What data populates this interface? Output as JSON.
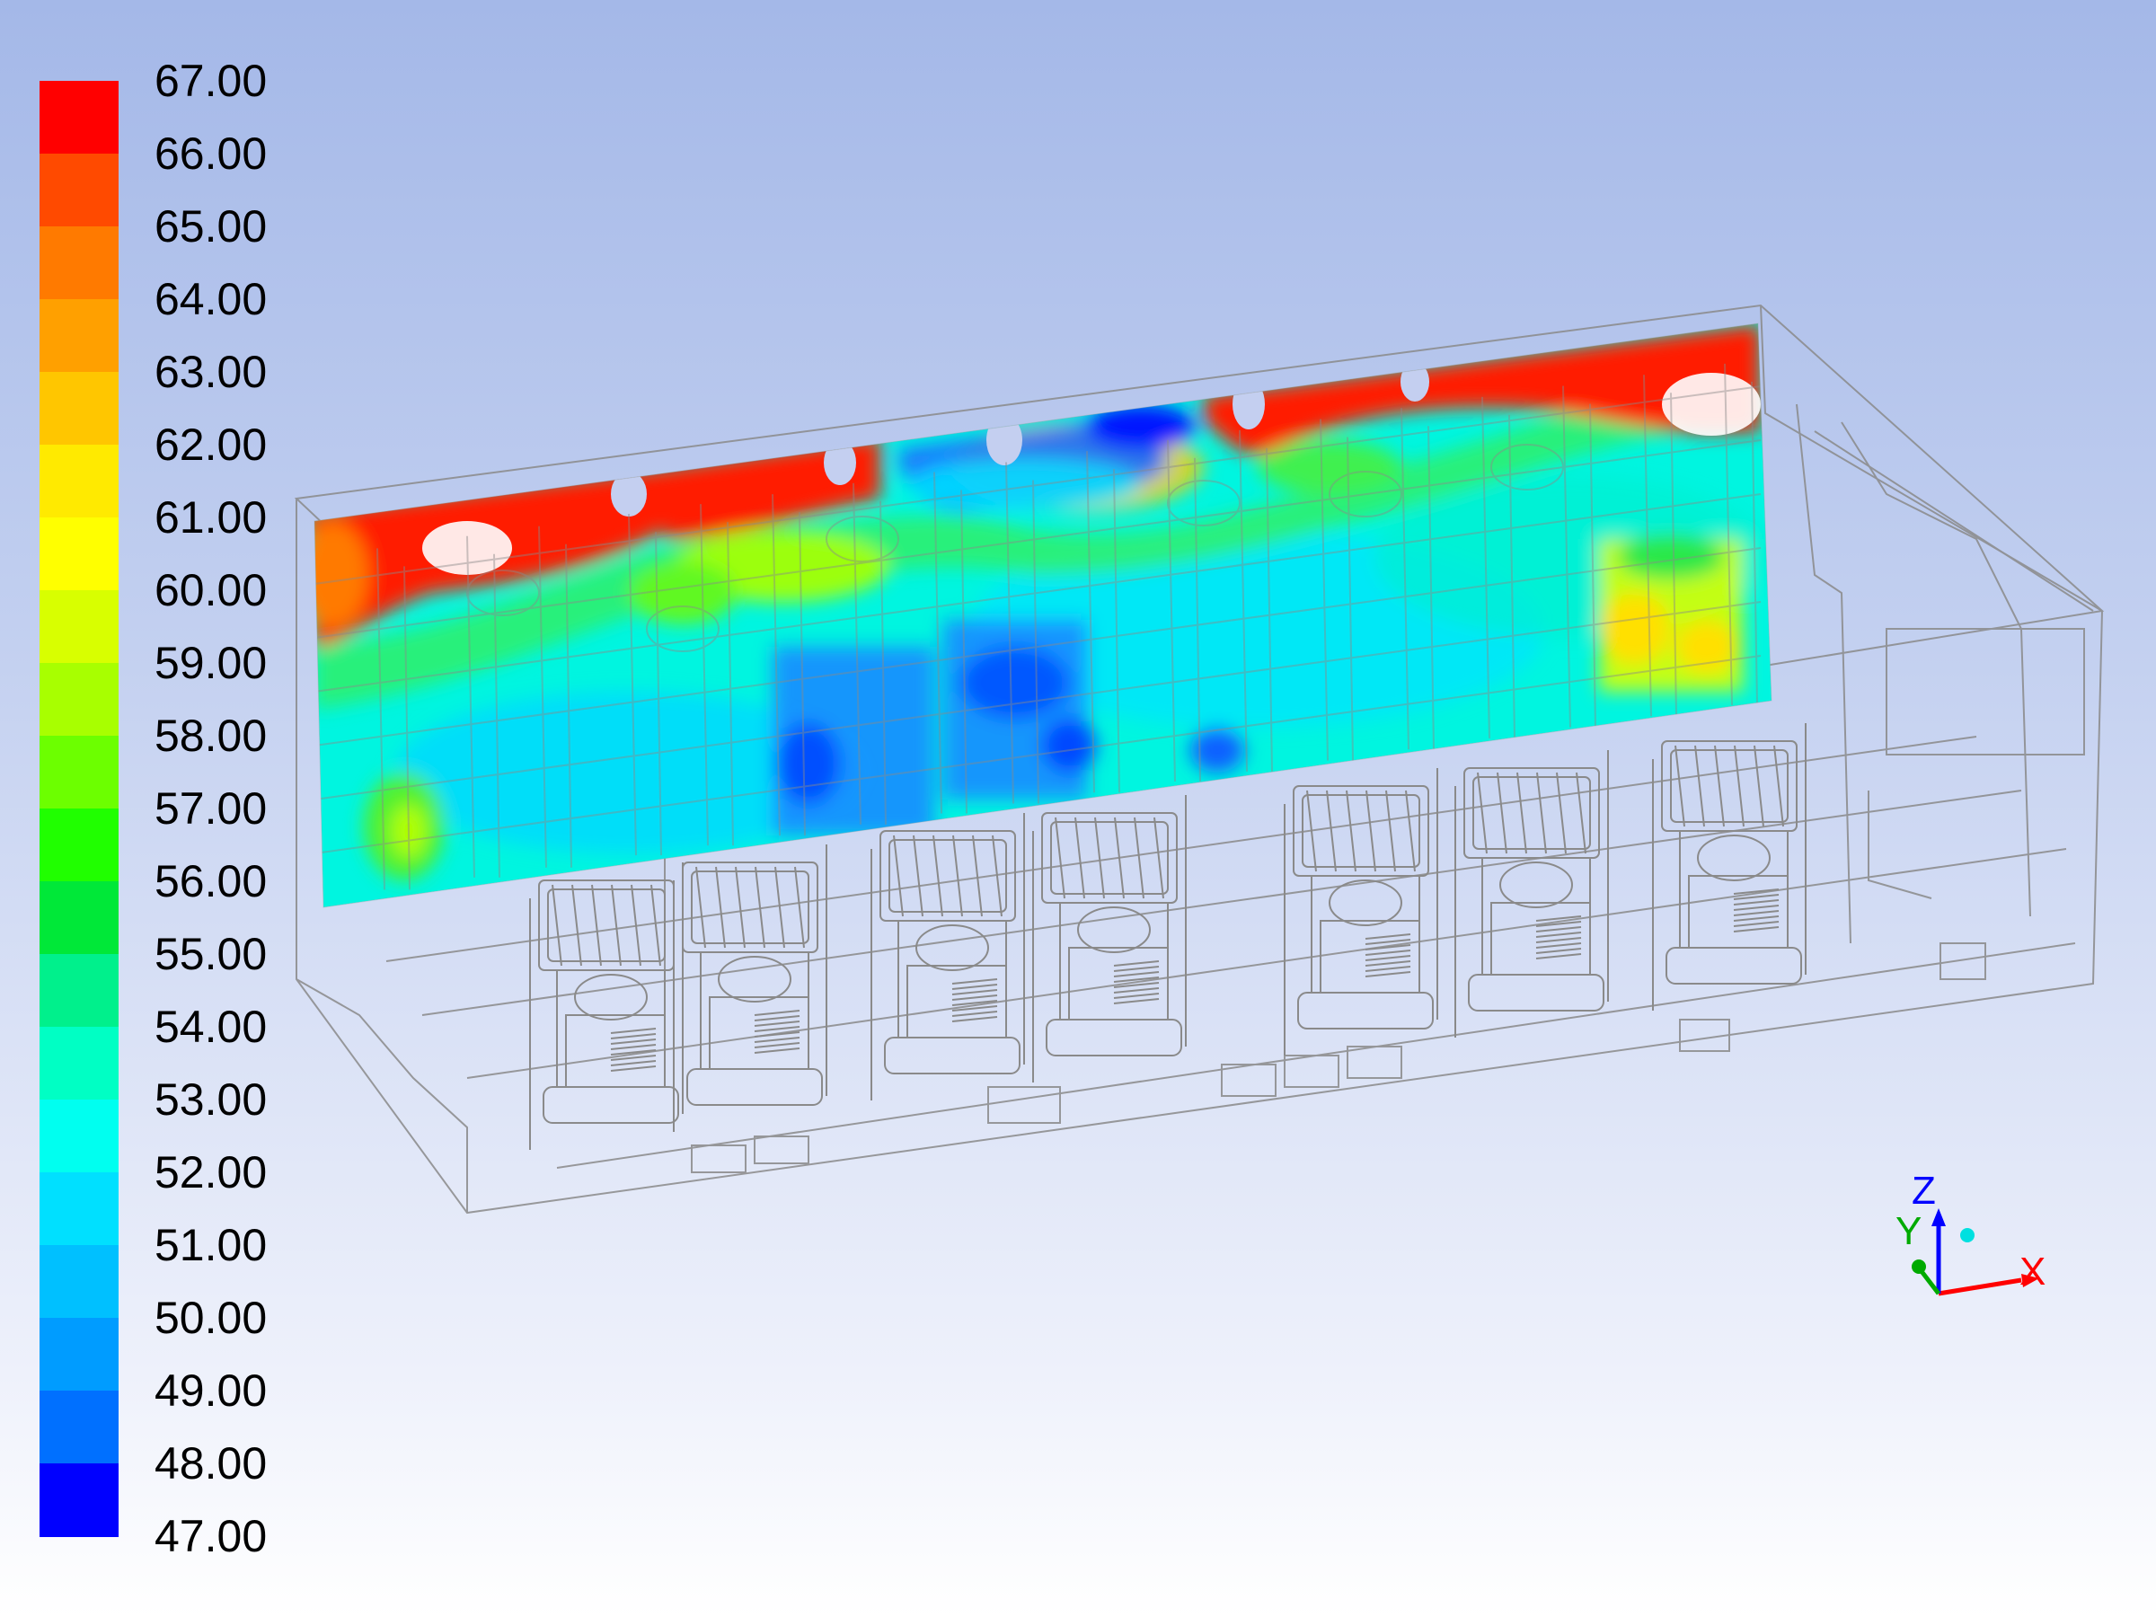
{
  "legend": {
    "labels": [
      "67.00",
      "66.00",
      "65.00",
      "64.00",
      "63.00",
      "62.00",
      "61.00",
      "60.00",
      "59.00",
      "58.00",
      "57.00",
      "56.00",
      "55.00",
      "54.00",
      "53.00",
      "52.00",
      "51.00",
      "50.00",
      "49.00",
      "48.00",
      "47.00"
    ],
    "colors": [
      "#ff0000",
      "#ff4a00",
      "#ff7a00",
      "#ffa000",
      "#ffc600",
      "#ffea00",
      "#ffff00",
      "#d8ff00",
      "#a8ff00",
      "#6cff00",
      "#20ff00",
      "#00e838",
      "#00f08c",
      "#00ffc4",
      "#00fff0",
      "#00e0ff",
      "#00c0ff",
      "#009cff",
      "#0070ff",
      "#0040ff",
      "#0000ff"
    ]
  },
  "axes": {
    "x": "X",
    "y": "Y",
    "z": "Z"
  },
  "colors": {
    "x_axis": "#ff0000",
    "y_axis": "#00aa00",
    "z_axis": "#0000ff",
    "wire": "#8a8a8a"
  }
}
